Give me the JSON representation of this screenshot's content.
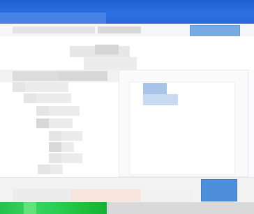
{
  "window": {
    "title": ""
  },
  "menu": {
    "search_placeholder": ""
  },
  "tree": {
    "items": [
      {
        "label": ""
      },
      {
        "label": ""
      },
      {
        "label": ""
      },
      {
        "label": ""
      },
      {
        "label": ""
      },
      {
        "label": ""
      },
      {
        "label": ""
      },
      {
        "label": ""
      }
    ]
  },
  "list": {
    "items": [
      {
        "label": ""
      },
      {
        "label": ""
      }
    ]
  },
  "footer": {
    "status_text": "",
    "primary_button_label": ""
  },
  "progress": {
    "fraction": 0.42,
    "color": "#22c24b"
  },
  "colors": {
    "titlebar": "#1f5fd1",
    "selection": "#a8c4e8",
    "primary_button": "#4e8fdb"
  }
}
